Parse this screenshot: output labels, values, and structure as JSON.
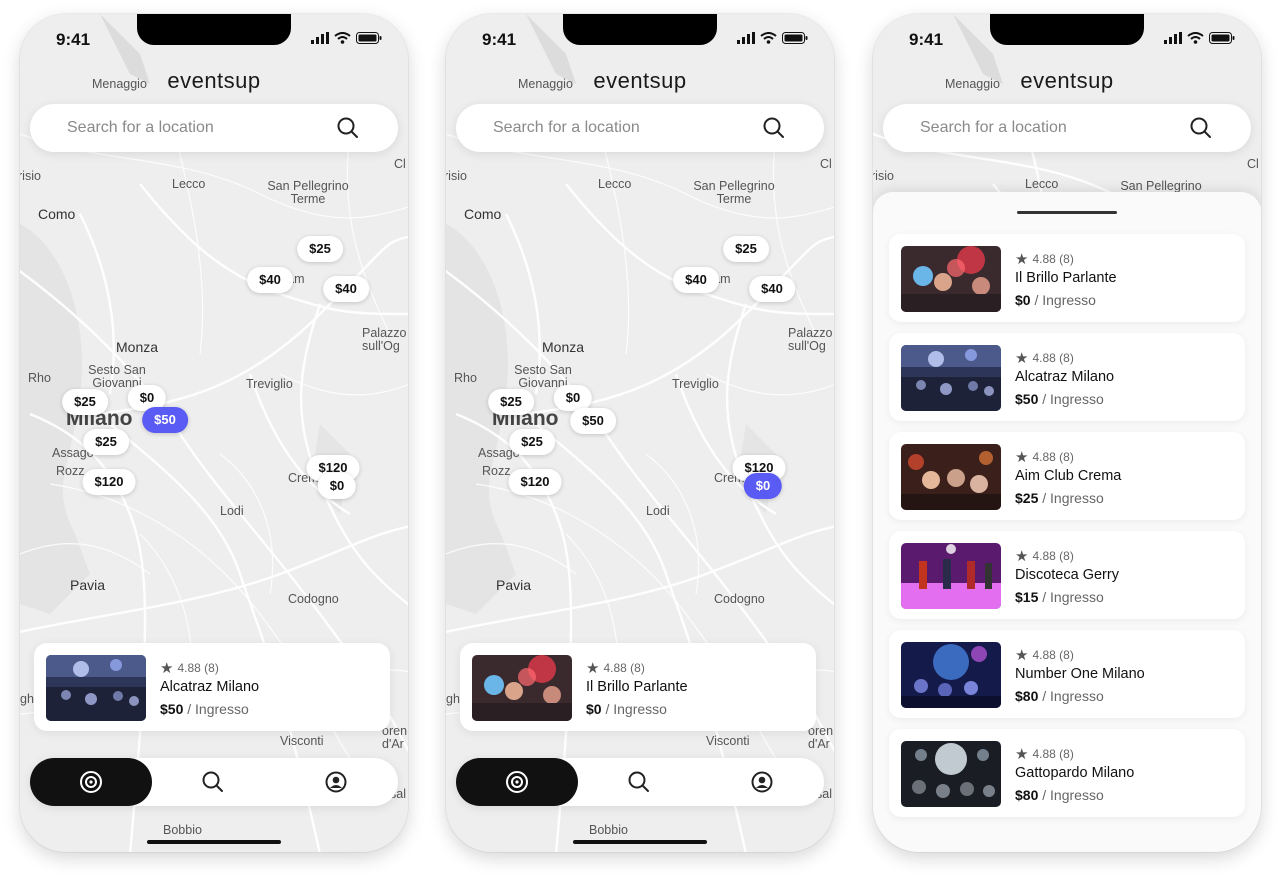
{
  "status": {
    "time": "9:41"
  },
  "app": {
    "logo": "eventsup"
  },
  "search": {
    "placeholder": "Search for a location",
    "icon": "search-icon"
  },
  "map_labels": [
    "Menaggio",
    "risio",
    "Como",
    "Lecco",
    "San Pellegrino Terme",
    "Cl",
    "rgam",
    "Palazzo sull'Og",
    "Monza",
    "Sesto San Giovanni",
    "Rho",
    "Treviglio",
    "Milano",
    "Assago",
    "Rozz",
    "Crem",
    "Lodi",
    "Pavia",
    "Codogno",
    "gh",
    "Visconti",
    "oren d'Ar",
    "sal",
    "Bobbio"
  ],
  "screens": [
    {
      "pins": [
        "$25",
        "$40",
        "$40",
        "$25",
        "$0",
        "$50",
        "$25",
        "$120",
        "$120",
        "$0"
      ],
      "selected_pin": "$50",
      "card": {
        "rating": "4.88 (8)",
        "name": "Alcatraz Milano",
        "price": "$50",
        "unit": "/ Ingresso"
      }
    },
    {
      "pins": [
        "$25",
        "$40",
        "$40",
        "$25",
        "$0",
        "$50",
        "$25",
        "$120",
        "$120",
        "$0"
      ],
      "selected_pin": "$0",
      "card": {
        "rating": "4.88 (8)",
        "name": "Il Brillo Parlante",
        "price": "$0",
        "unit": "/ Ingresso"
      }
    },
    {
      "list": [
        {
          "rating": "4.88 (8)",
          "name": "Il Brillo Parlante",
          "price": "$0",
          "unit": "/ Ingresso"
        },
        {
          "rating": "4.88 (8)",
          "name": "Alcatraz Milano",
          "price": "$50",
          "unit": "/ Ingresso"
        },
        {
          "rating": "4.88 (8)",
          "name": "Aim Club Crema",
          "price": "$25",
          "unit": "/ Ingresso"
        },
        {
          "rating": "4.88 (8)",
          "name": "Discoteca Gerry",
          "price": "$15",
          "unit": "/ Ingresso"
        },
        {
          "rating": "4.88 (8)",
          "name": "Number One Milano",
          "price": "$80",
          "unit": "/ Ingresso"
        },
        {
          "rating": "4.88 (8)",
          "name": "Gattopardo Milano",
          "price": "$80",
          "unit": "/ Ingresso"
        }
      ]
    }
  ],
  "nav": [
    {
      "icon": "explore-target-icon",
      "active": true
    },
    {
      "icon": "search-icon",
      "active": false
    },
    {
      "icon": "profile-icon",
      "active": false
    }
  ],
  "colors": {
    "accent": "#5a5af5",
    "dark": "#111111",
    "map_bg": "#eeeeee"
  }
}
